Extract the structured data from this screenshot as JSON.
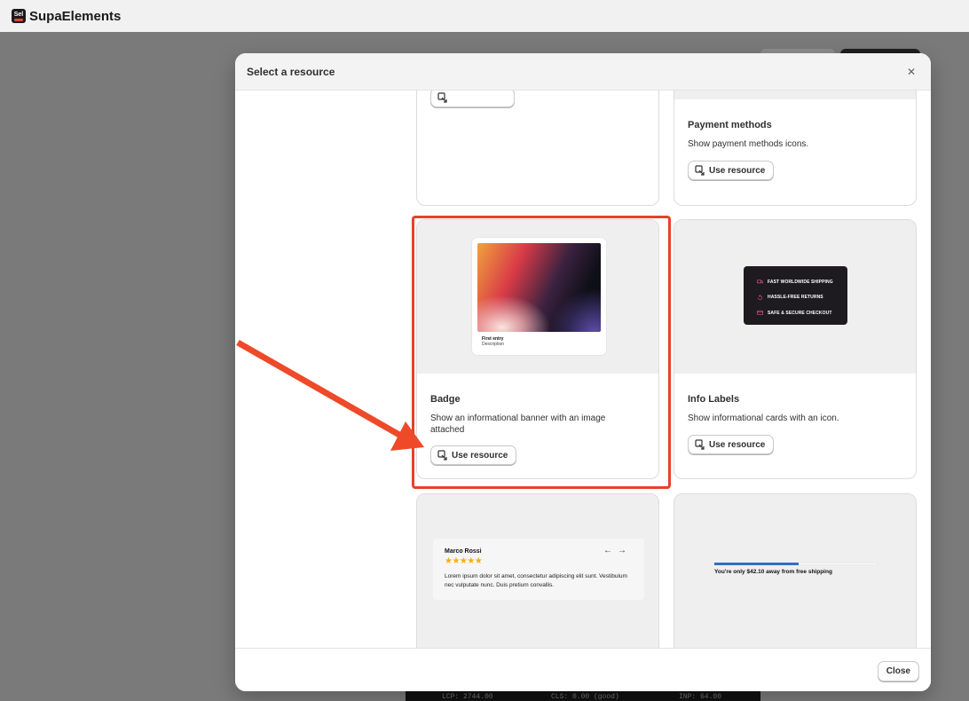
{
  "app": {
    "title": "SupaElements",
    "logo_text": "Sel"
  },
  "perf": {
    "lcp": "LCP: 2744.00",
    "cls": "CLS: 0.00 (good)",
    "inp": "INP: 64.00"
  },
  "modal": {
    "title": "Select a resource",
    "close_label": "Close",
    "use_label": "Use resource",
    "cards": {
      "payment": {
        "name": "Payment methods",
        "description": "Show payment methods icons."
      },
      "badge": {
        "name": "Badge",
        "description": "Show an informational banner with an image attached",
        "preview_title": "First entry",
        "preview_subtitle": "Description"
      },
      "info": {
        "name": "Info Labels",
        "description": "Show informational cards with an icon.",
        "rows": [
          "FAST WORLDWIDE SHIPPING",
          "HASSLE-FREE RETURNS",
          "SAFE & SECURE CHECKOUT"
        ]
      },
      "review": {
        "reviewer": "Marco Rossi",
        "stars": "★★★★★",
        "text": "Lorem ipsum dolor sit amet, consectetur adipiscing elit sunt. Vestibulum nec vulputate nunc. Duis pretium convallis."
      },
      "shipping": {
        "text": "You're only $42.10 away from free shipping",
        "progress": 0.52
      }
    }
  },
  "colors": {
    "highlight": "#e8412c",
    "progress": "#2f6fc6",
    "stars": "#f5b000"
  }
}
